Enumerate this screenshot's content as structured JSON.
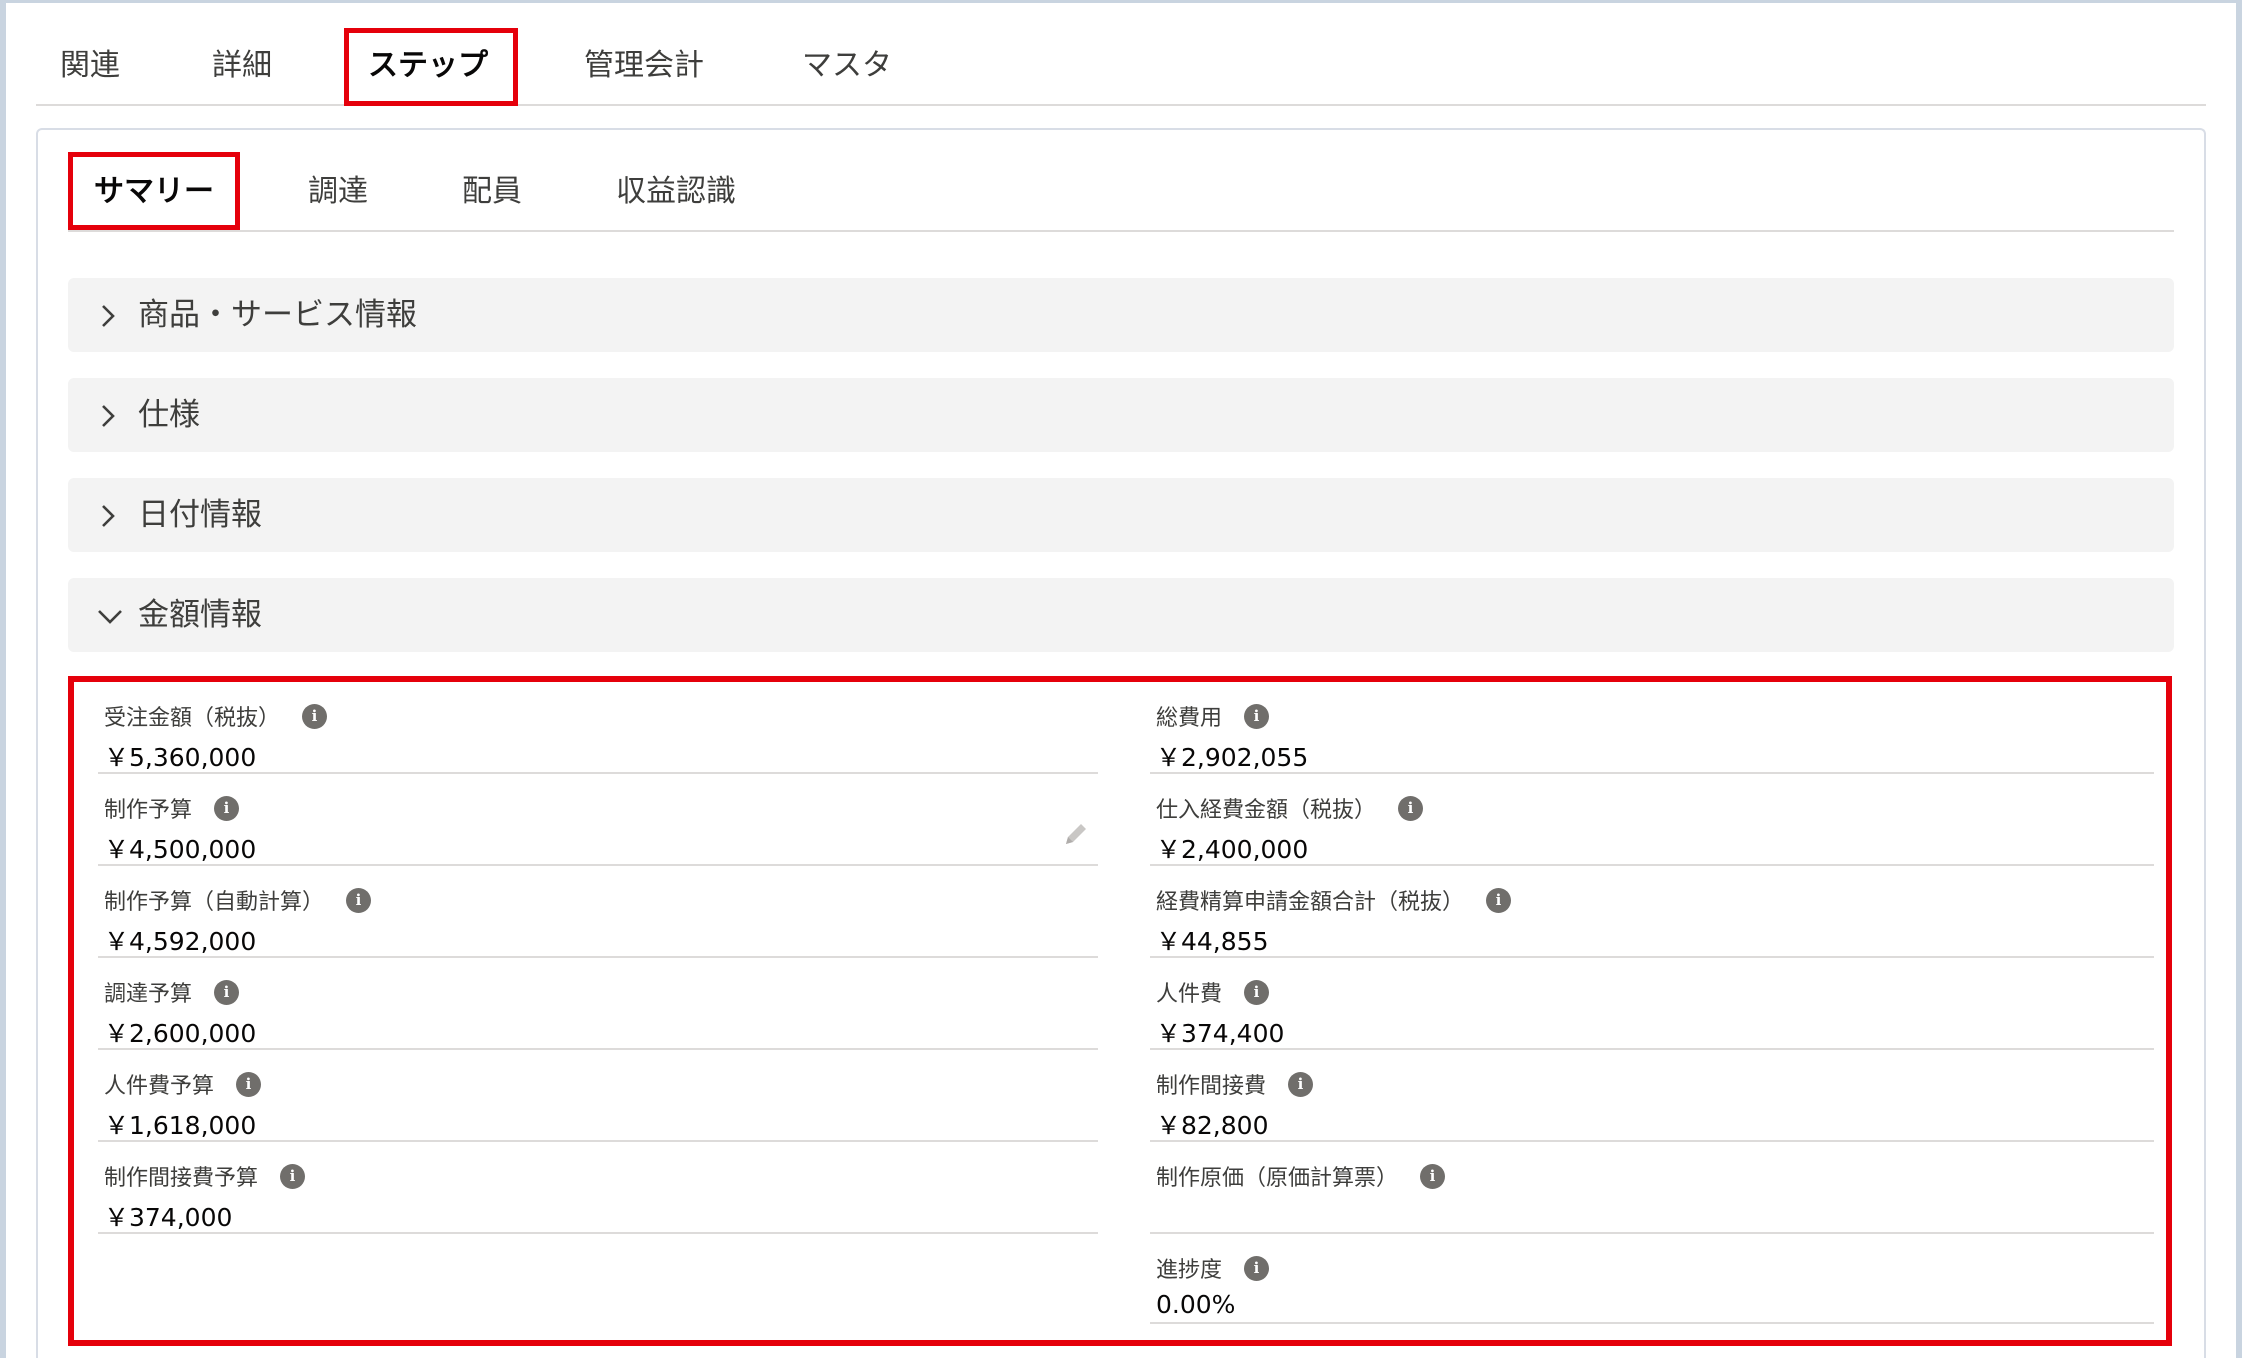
{
  "top_tabs": [
    {
      "label": "関連"
    },
    {
      "label": "詳細"
    },
    {
      "label": "ステップ"
    },
    {
      "label": "管理会計"
    },
    {
      "label": "マスタ"
    }
  ],
  "sub_tabs": [
    {
      "label": "サマリー"
    },
    {
      "label": "調達"
    },
    {
      "label": "配員"
    },
    {
      "label": "収益認識"
    }
  ],
  "sections": [
    {
      "title": "商品・サービス情報",
      "state": "collapsed"
    },
    {
      "title": "仕様",
      "state": "collapsed"
    },
    {
      "title": "日付情報",
      "state": "collapsed"
    },
    {
      "title": "金額情報",
      "state": "expanded"
    }
  ],
  "left_fields": [
    {
      "label": "受注金額（税抜）",
      "value": "￥5,360,000"
    },
    {
      "label": "制作予算",
      "value": "￥4,500,000"
    },
    {
      "label": "制作予算（自動計算）",
      "value": "￥4,592,000"
    },
    {
      "label": "調達予算",
      "value": "￥2,600,000"
    },
    {
      "label": "人件費予算",
      "value": "￥1,618,000"
    },
    {
      "label": "制作間接費予算",
      "value": "￥374,000"
    }
  ],
  "right_fields": [
    {
      "label": "総費用",
      "value": "￥2,902,055"
    },
    {
      "label": "仕入経費金額（税抜）",
      "value": "￥2,400,000"
    },
    {
      "label": "経費精算申請金額合計（税抜）",
      "value": "￥44,855"
    },
    {
      "label": "人件費",
      "value": "￥374,400"
    },
    {
      "label": "制作間接費",
      "value": "￥82,800"
    },
    {
      "label": "制作原価（原価計算票）",
      "value": ""
    },
    {
      "label": "進捗度",
      "value": "0.00%"
    }
  ],
  "icons": {
    "info": "info-icon",
    "edit": "pencil-icon",
    "collapsed": "chevron-right-icon",
    "expanded": "chevron-down-icon"
  },
  "colors": {
    "highlight": "#e5000b",
    "section_bg": "#f3f3f3",
    "info_icon": "#706e6b"
  }
}
